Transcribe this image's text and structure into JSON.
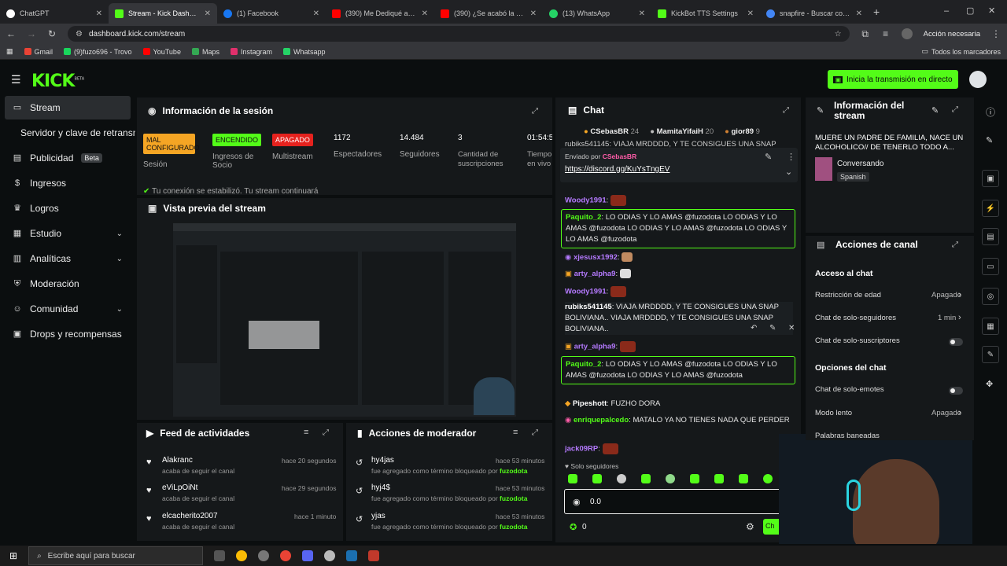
{
  "browser": {
    "tabs": [
      {
        "label": "ChatGPT",
        "color": "#ffffff"
      },
      {
        "label": "Stream - Kick Dashboard",
        "color": "#53fc18"
      },
      {
        "label": "(1) Facebook",
        "color": "#1877f2"
      },
      {
        "label": "(390) Me Dediqué a Pe...",
        "color": "#ff0000"
      },
      {
        "label": "(390) ¿Se acabó la amist...",
        "color": "#ff0000"
      },
      {
        "label": "(13) WhatsApp",
        "color": "#25d366"
      },
      {
        "label": "KickBot TTS Settings",
        "color": "#53fc18"
      },
      {
        "label": "snapfire - Buscar con Goo...",
        "color": "#4285f4"
      }
    ],
    "url": "dashboard.kick.com/stream",
    "profile_label": "Acción necesaria",
    "bookmarks": [
      {
        "label": "Gmail",
        "color": "#ea4335"
      },
      {
        "label": "(9)fuzo696 - Trovo",
        "color": "#19d65c"
      },
      {
        "label": "YouTube",
        "color": "#ff0000"
      },
      {
        "label": "Maps",
        "color": "#34a853"
      },
      {
        "label": "Instagram",
        "color": "#e1306c"
      },
      {
        "label": "Whatsapp",
        "color": "#25d366"
      }
    ],
    "all_bookmarks": "Todos los marcadores"
  },
  "app": {
    "logo": "KICK",
    "logo_sup": "BETA",
    "go_live": "Inicia la transmisión en directo",
    "accent": "#53fc18"
  },
  "sidebar": {
    "items": [
      {
        "label": "Stream",
        "icon": "stream-icon"
      },
      {
        "label": "Servidor y clave de retransm",
        "icon": ""
      },
      {
        "label": "Publicidad",
        "icon": "ad-icon",
        "badge": "Beta"
      },
      {
        "label": "Ingresos",
        "icon": "money-icon"
      },
      {
        "label": "Logros",
        "icon": "trophy-icon"
      },
      {
        "label": "Estudio",
        "icon": "studio-icon"
      },
      {
        "label": "Analíticas",
        "icon": "chart-icon"
      },
      {
        "label": "Moderación",
        "icon": "shield-icon"
      },
      {
        "label": "Comunidad",
        "icon": "people-icon"
      },
      {
        "label": "Drops y recompensas",
        "icon": "gift-icon"
      }
    ]
  },
  "session": {
    "title": "Información de la sesión",
    "session_badge": "MAL CONFIGURADO",
    "session_label": "Sesión",
    "socio_badge": "ENCENDIDO",
    "socio_label": "Ingresos de Socio",
    "multi_badge": "APAGADO",
    "multi_label": "Multistream",
    "viewers": "1172",
    "viewers_label": "Espectadores",
    "followers": "14.484",
    "followers_label": "Seguidores",
    "subs": "3",
    "subs_label": "Cantidad de suscripciones",
    "time": "01:54:5",
    "time_label": "Tiempo en vivo",
    "notice": "Tu conexión se estabilizó. Tu stream continuará"
  },
  "preview": {
    "title": "Vista previa del stream"
  },
  "feed": {
    "title": "Feed de actividades",
    "items": [
      {
        "user": "Alakranc",
        "action": "acaba de seguir el canal",
        "time": "hace 20 segundos"
      },
      {
        "user": "eViLpOiNt",
        "action": "acaba de seguir el canal",
        "time": "hace 29 segundos"
      },
      {
        "user": "elcacherito2007",
        "action": "acaba de seguir el canal",
        "time": "hace 1 minuto"
      }
    ]
  },
  "modactions": {
    "title": "Acciones de moderador",
    "items": [
      {
        "term": "hy4jas",
        "action": "fue agregado como término bloqueado por",
        "by": "fuzodota",
        "time": "hace 53 minutos"
      },
      {
        "term": "hyj4$",
        "action": "fue agregado como término bloqueado por",
        "by": "fuzodota",
        "time": "hace 53 minutos"
      },
      {
        "term": "yjas",
        "action": "fue agregado como término bloqueado por",
        "by": "fuzodota",
        "time": "hace 53 minutos"
      }
    ]
  },
  "chat": {
    "title": "Chat",
    "top_gifters": [
      {
        "name": "CSebasBR",
        "count": "24"
      },
      {
        "name": "MamitaYifaiH",
        "count": "20"
      },
      {
        "name": "gior89",
        "count": "9"
      }
    ],
    "pinned_label": "Enviado por",
    "pinned_user": "CSebasBR",
    "pinned_link": "https://discord.gg/KuYsTngEV",
    "truncated_top": "rubiks541145: VIAJA MRDDDD, Y TE CONSIGUES UNA SNAP",
    "messages": [
      {
        "user": "Woody1991",
        "text": "",
        "color": "#b57aff"
      },
      {
        "user": "Paquito_2",
        "text": "LO ODIAS Y LO AMAS @fuzodota LO ODIAS Y LO AMAS @fuzodota LO ODIAS Y LO AMAS @fuzodota LO ODIAS Y LO AMAS @fuzodota",
        "color": "#53fc18"
      },
      {
        "user": "xjesusx1992",
        "text": "",
        "color": "#b57aff"
      },
      {
        "user": "arty_alpha9",
        "text": "",
        "color": "#b57aff"
      },
      {
        "user": "Woody1991",
        "text": "",
        "color": "#b57aff"
      },
      {
        "user": "rubiks541145",
        "text": "VIAJA MRDDDD, Y TE CONSIGUES UNA SNAP BOLIVIANA.. VIAJA MRDDDD, Y TE CONSIGUES UNA SNAP BOLIVIANA..",
        "color": "#ffffff"
      },
      {
        "user": "arty_alpha9",
        "text": "",
        "color": "#b57aff"
      },
      {
        "user": "Paquito_2",
        "text": "LO ODIAS Y LO AMAS @fuzodota LO ODIAS Y LO AMAS @fuzodota LO ODIAS Y LO AMAS @fuzodota",
        "color": "#53fc18"
      },
      {
        "user": "Pipeshott",
        "text": "FUZHO DORA",
        "color": "#ffffff"
      },
      {
        "user": "enriquepalcedo",
        "text": "MATALO YA NO TIENES NADA QUE PERDER",
        "color": "#53fc18"
      },
      {
        "user": "jack09RP",
        "text": "",
        "color": "#b57aff"
      }
    ],
    "followers_only": "Solo seguidores",
    "input_value": "0.0",
    "points": "0",
    "send_label": "Ch"
  },
  "channel_info": {
    "title": "Información del stream",
    "stream_title": "MUERE UN PADRE DE FAMILIA, NACE UN ALCOHOLICO// DE TENERLO TODO A...",
    "category": "Conversando",
    "language": "Spanish"
  },
  "channel_actions": {
    "title": "Acciones de canal",
    "chat_access": "Acceso al chat",
    "rows": [
      {
        "label": "Restricción de edad",
        "value": "Apagado"
      },
      {
        "label": "Chat de solo-seguidores",
        "value": "1 min"
      },
      {
        "label": "Chat de solo-suscriptores",
        "value": ""
      }
    ],
    "options_title": "Opciones del chat",
    "options": [
      {
        "label": "Chat de solo-emotes",
        "value": ""
      },
      {
        "label": "Modo lento",
        "value": "Apagado"
      },
      {
        "label": "Palabras baneadas",
        "value": ""
      }
    ]
  },
  "taskbar": {
    "search_placeholder": "Escribe aquí para buscar"
  }
}
